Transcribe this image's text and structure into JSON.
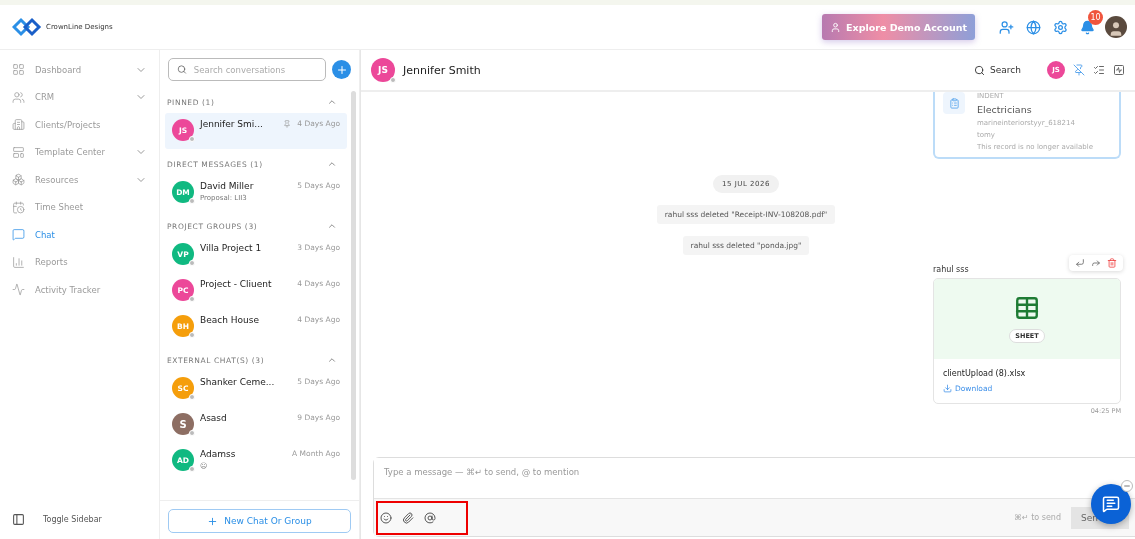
{
  "brand": {
    "name": "CrownLine Designs"
  },
  "topbar": {
    "demo_button": "Explore Demo Account",
    "notification_count": "10"
  },
  "nav": {
    "items": [
      {
        "label": "Dashboard",
        "expandable": true,
        "selected": false
      },
      {
        "label": "CRM",
        "expandable": true,
        "selected": false
      },
      {
        "label": "Clients/Projects",
        "expandable": false,
        "selected": false
      },
      {
        "label": "Template Center",
        "expandable": true,
        "selected": false
      },
      {
        "label": "Resources",
        "expandable": true,
        "selected": false
      },
      {
        "label": "Time Sheet",
        "expandable": false,
        "selected": false
      },
      {
        "label": "Chat",
        "expandable": false,
        "selected": true
      },
      {
        "label": "Reports",
        "expandable": false,
        "selected": false
      },
      {
        "label": "Activity Tracker",
        "expandable": false,
        "selected": false
      }
    ],
    "toggle": "Toggle Sidebar"
  },
  "conversations": {
    "search_placeholder": "Search conversations",
    "new_button": "New Chat Or Group",
    "sections": [
      {
        "title": "PINNED (1)",
        "expanded": true,
        "items": [
          {
            "initials": "JS",
            "name": "Jennifer Smi...",
            "time": "4 Days Ago",
            "pinned": true,
            "selected": true,
            "color": "#ec4899"
          }
        ]
      },
      {
        "title": "DIRECT MESSAGES (1)",
        "expanded": true,
        "items": [
          {
            "initials": "DM",
            "name": "David Miller",
            "time": "5 Days Ago",
            "subtitle": "Proposal: LII3",
            "pinned": false,
            "selected": false,
            "color": "#10b981"
          }
        ]
      },
      {
        "title": "PROJECT GROUPS (3)",
        "expanded": true,
        "items": [
          {
            "initials": "VP",
            "name": "Villa Project 1",
            "time": "3 Days Ago",
            "pinned": false,
            "selected": false,
            "color": "#10b981"
          },
          {
            "initials": "PC",
            "name": "Project - Cliuent",
            "time": "4 Days Ago",
            "pinned": false,
            "selected": false,
            "color": "#ec4899"
          },
          {
            "initials": "BH",
            "name": "Beach House",
            "time": "4 Days Ago",
            "pinned": false,
            "selected": false,
            "color": "#f59e0b"
          }
        ]
      },
      {
        "title": "EXTERNAL CHAT(S) (3)",
        "expanded": true,
        "items": [
          {
            "initials": "SC",
            "name": "Shanker Ceme...",
            "time": "5 Days Ago",
            "pinned": false,
            "selected": false,
            "color": "#f59e0b"
          },
          {
            "initials": "S",
            "name": "Asasd",
            "time": "9 Days Ago",
            "pinned": false,
            "selected": false,
            "color": "#8d6e63"
          },
          {
            "initials": "AD",
            "name": "Adamss",
            "time": "A Month Ago",
            "subtitle": "😐",
            "pinned": false,
            "selected": false,
            "color": "#10b981"
          }
        ]
      }
    ]
  },
  "chat": {
    "header": {
      "initials": "JS",
      "name": "Jennifer Smith",
      "search": "Search",
      "member_initials": "JS"
    },
    "record_card": {
      "type": "INDENT",
      "title": "Electricians",
      "lines": [
        "marineinteriorstyyr_618214",
        "tomy"
      ],
      "note": "This record is no longer available"
    },
    "date": "15 JUL 2026",
    "events": [
      "rahul sss deleted \"Receipt-INV-108208.pdf\"",
      "rahul sss deleted \"ponda.jpg\""
    ],
    "message": {
      "sender": "rahul sss",
      "file_type": "SHEET",
      "file_name": "clientUpload (8).xlsx",
      "download": "Download",
      "time": "04:25 PM"
    },
    "composer": {
      "placeholder": "Type a message — ⌘↵ to send, @ to mention",
      "hint": "⌘↵ to send",
      "send": "Sen"
    }
  }
}
